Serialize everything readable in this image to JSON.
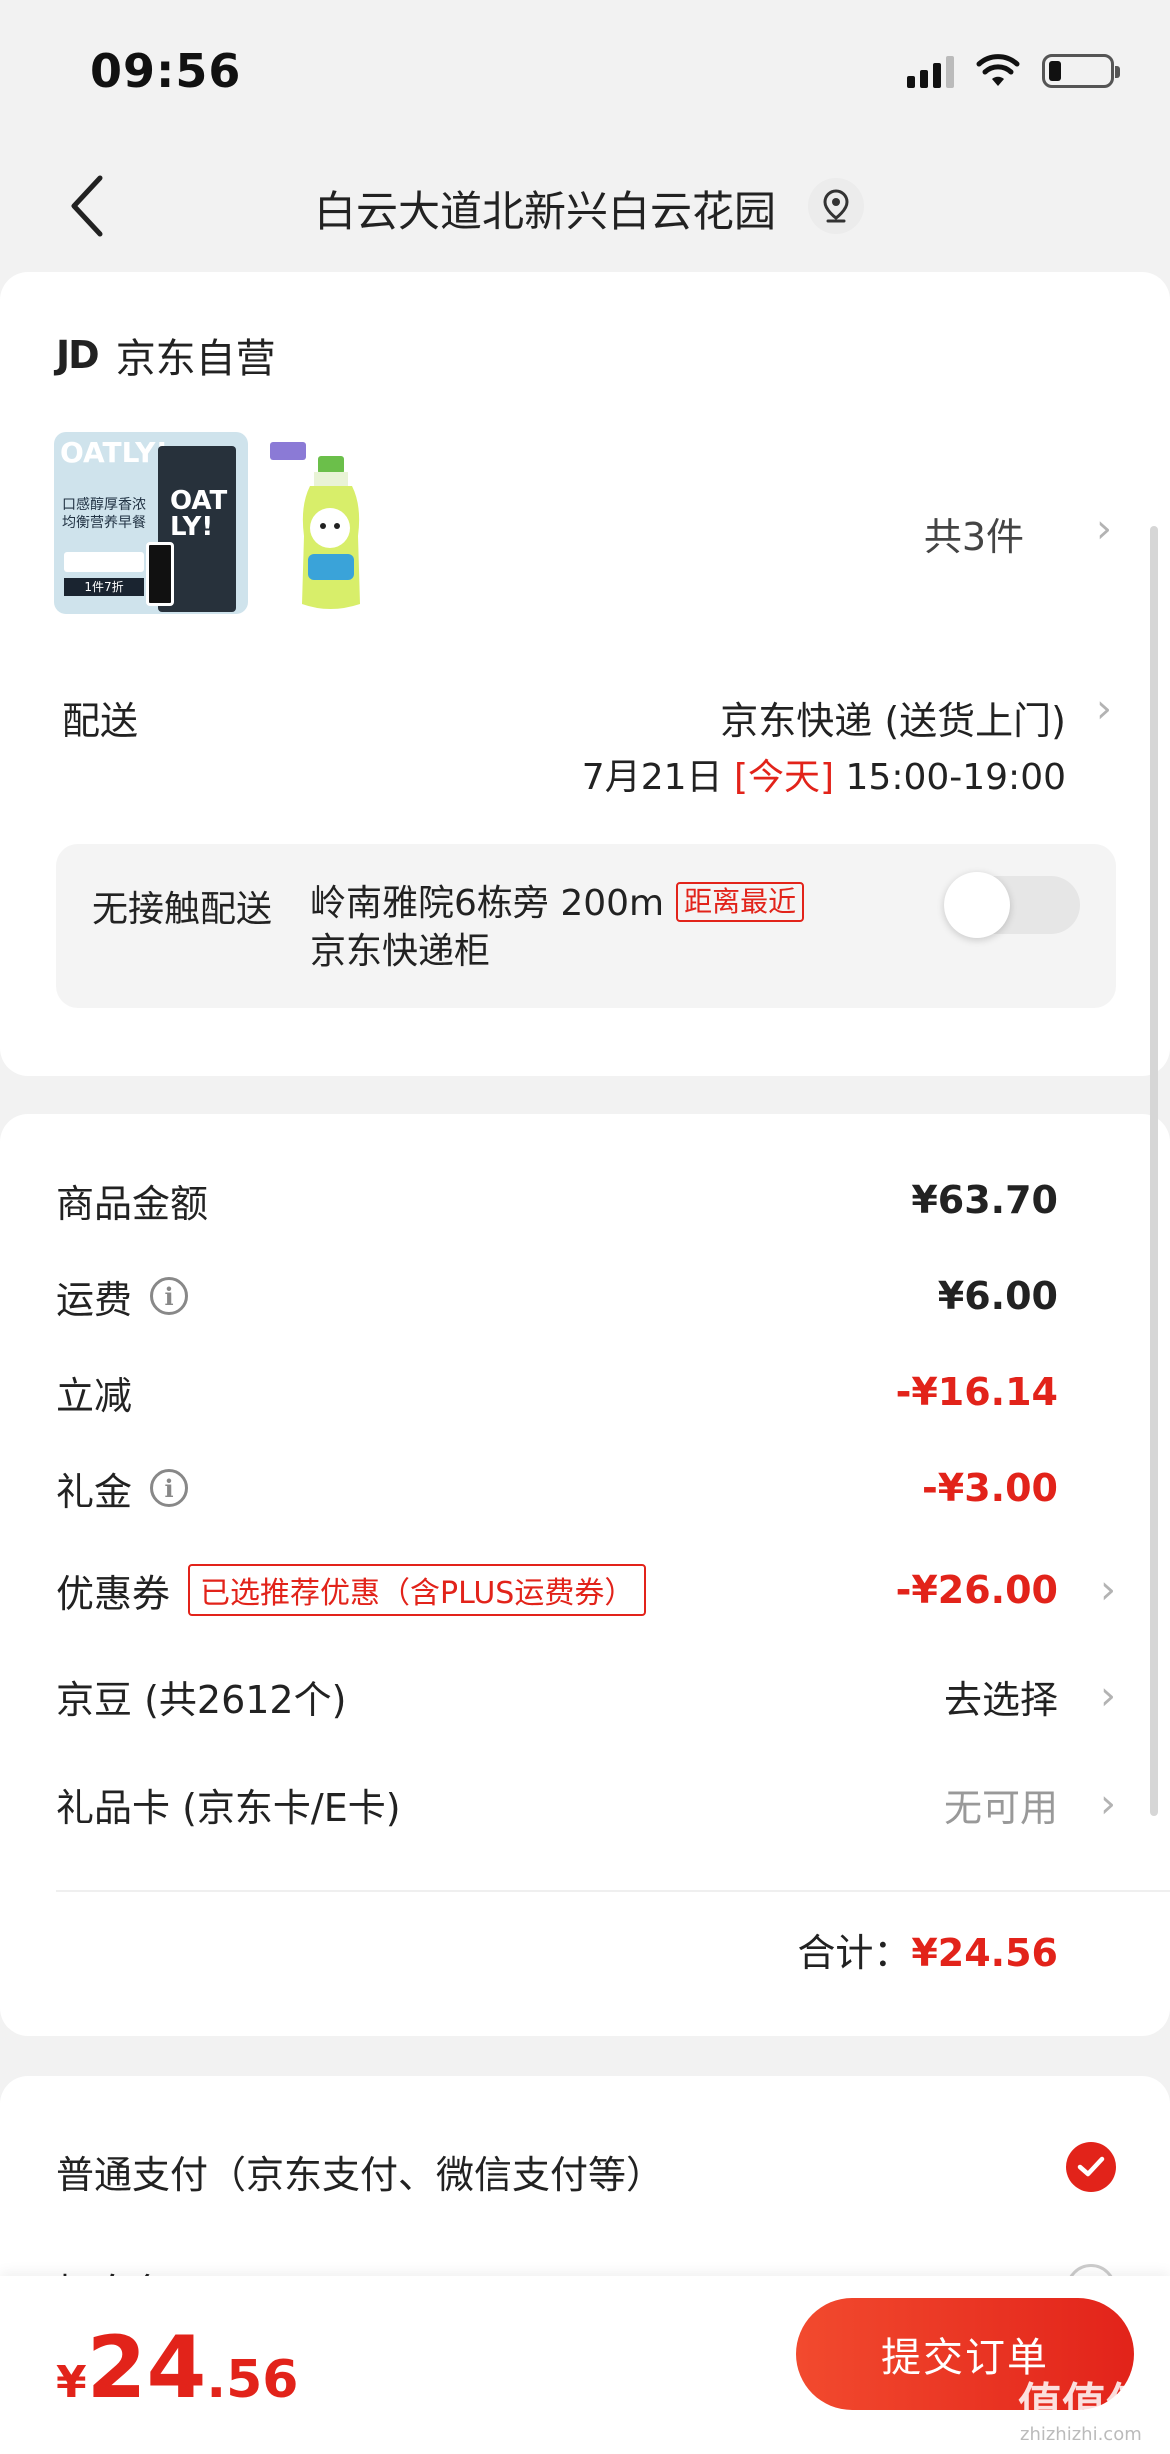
{
  "status_bar": {
    "time": "09:56"
  },
  "nav": {
    "title": "白云大道北新兴白云花园"
  },
  "store": {
    "logo": "JD",
    "name": "京东自营"
  },
  "products": {
    "count_text": "共3件",
    "item1_brand": "OAT\nLY!",
    "item1_tag": "口感醇厚香浓 均衡营养早餐",
    "item1_price_tag": "1件7折"
  },
  "delivery": {
    "label": "配送",
    "type": "京东快递 (送货上门)",
    "date": "7月21日",
    "today": "[今天]",
    "time": "15:00-19:00"
  },
  "contactless": {
    "label": "无接触配送",
    "address": "岭南雅院6栋旁 200m",
    "tag": "距离最近",
    "address_line2": "京东快递柜",
    "enabled": false
  },
  "pricing": {
    "goods_label": "商品金额",
    "goods_value": "¥63.70",
    "shipping_label": "运费",
    "shipping_value": "¥6.00",
    "discount_label": "立减",
    "discount_value": "-¥16.14",
    "gift_label": "礼金",
    "gift_value": "-¥3.00",
    "coupon_label": "优惠券",
    "coupon_tag": "已选推荐优惠（含PLUS运费券）",
    "coupon_value": "-¥26.00",
    "beans_label": "京豆 (共2612个)",
    "beans_value": "去选择",
    "giftcard_label": "礼品卡 (京东卡/E卡)",
    "giftcard_value": "无可用",
    "total_label": "合计：",
    "total_value": "¥24.56"
  },
  "payment": {
    "option1": "普通支付（京东支付、微信支付等）",
    "option2": "打白条"
  },
  "bottom": {
    "currency": "¥",
    "amount_int": "24",
    "amount_dec": ".56",
    "submit_label": "提交订单"
  },
  "watermark": {
    "text": "值值值",
    "sub": "zhizhizhi.com"
  },
  "colors": {
    "accent": "#e2231a"
  }
}
